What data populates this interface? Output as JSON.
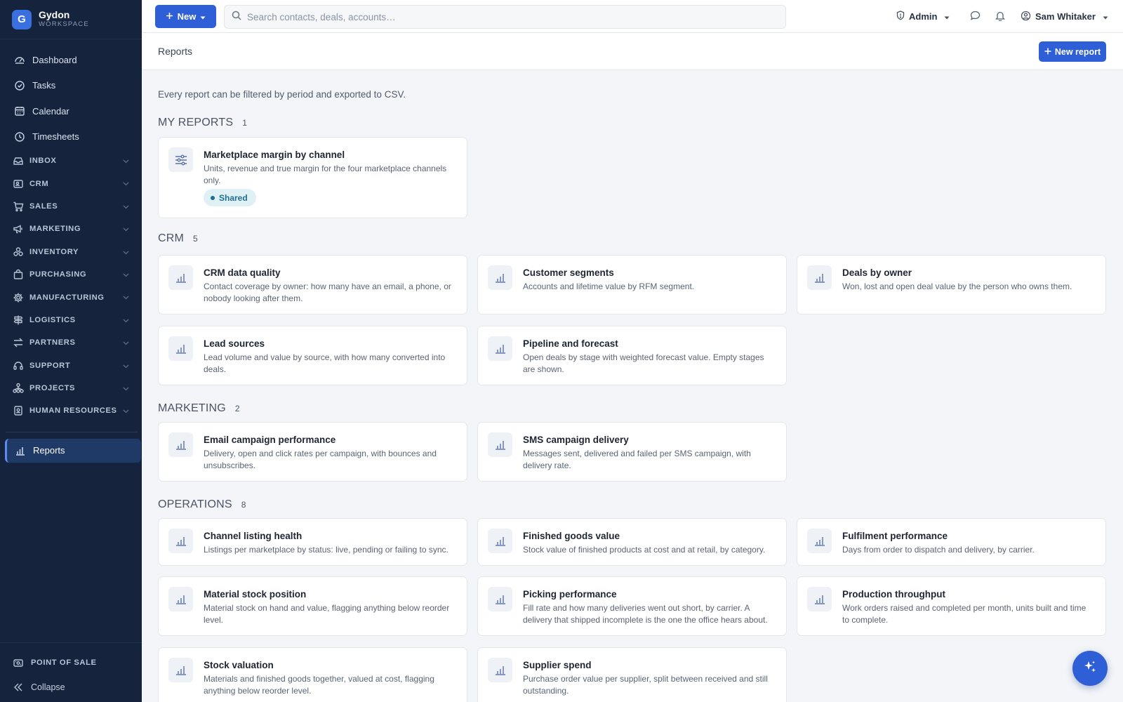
{
  "brand": {
    "logo_letter": "G",
    "name": "Gydon",
    "subtitle": "WORKSPACE"
  },
  "sidebar": {
    "items": [
      {
        "label": "Dashboard",
        "icon": "gauge-icon"
      },
      {
        "label": "Tasks",
        "icon": "check-circle-icon"
      },
      {
        "label": "Calendar",
        "icon": "calendar-icon"
      },
      {
        "label": "Timesheets",
        "icon": "clock-icon"
      }
    ],
    "groups": [
      {
        "label": "INBOX",
        "icon": "inbox-icon"
      },
      {
        "label": "CRM",
        "icon": "contact-card-icon"
      },
      {
        "label": "SALES",
        "icon": "cart-icon"
      },
      {
        "label": "MARKETING",
        "icon": "megaphone-icon"
      },
      {
        "label": "INVENTORY",
        "icon": "boxes-icon"
      },
      {
        "label": "PURCHASING",
        "icon": "bag-icon"
      },
      {
        "label": "MANUFACTURING",
        "icon": "cog-icon"
      },
      {
        "label": "LOGISTICS",
        "icon": "signpost-icon"
      },
      {
        "label": "PARTNERS",
        "icon": "arrows-icon"
      },
      {
        "label": "SUPPORT",
        "icon": "headset-icon"
      },
      {
        "label": "PROJECTS",
        "icon": "network-icon"
      },
      {
        "label": "HUMAN RESOURCES",
        "icon": "badge-icon"
      }
    ],
    "active": {
      "label": "Reports",
      "icon": "bar-chart-icon"
    },
    "bottom": {
      "pos_label": "POINT OF SALE",
      "collapse_label": "Collapse"
    }
  },
  "topbar": {
    "new_label": "New",
    "search_placeholder": "Search contacts, deals, accounts…",
    "admin_label": "Admin",
    "user_name": "Sam Whitaker"
  },
  "page": {
    "title": "Reports",
    "new_report_label": "New report",
    "intro": "Every report can be filtered by period and exported to CSV."
  },
  "sections": {
    "my": {
      "title": "MY REPORTS",
      "count": "1",
      "cards": [
        {
          "title": "Marketplace margin by channel",
          "desc": "Units, revenue and true margin for the four marketplace channels only.",
          "badge": "Shared"
        }
      ]
    },
    "crm": {
      "title": "CRM",
      "count": "5",
      "cards": [
        {
          "title": "CRM data quality",
          "desc": "Contact coverage by owner: how many have an email, a phone, or nobody looking after them."
        },
        {
          "title": "Customer segments",
          "desc": "Accounts and lifetime value by RFM segment."
        },
        {
          "title": "Deals by owner",
          "desc": "Won, lost and open deal value by the person who owns them."
        },
        {
          "title": "Lead sources",
          "desc": "Lead volume and value by source, with how many converted into deals."
        },
        {
          "title": "Pipeline and forecast",
          "desc": "Open deals by stage with weighted forecast value. Empty stages are shown."
        }
      ]
    },
    "marketing": {
      "title": "MARKETING",
      "count": "2",
      "cards": [
        {
          "title": "Email campaign performance",
          "desc": "Delivery, open and click rates per campaign, with bounces and unsubscribes."
        },
        {
          "title": "SMS campaign delivery",
          "desc": "Messages sent, delivered and failed per SMS campaign, with delivery rate."
        }
      ]
    },
    "operations": {
      "title": "OPERATIONS",
      "count": "8",
      "cards": [
        {
          "title": "Channel listing health",
          "desc": "Listings per marketplace by status: live, pending or failing to sync."
        },
        {
          "title": "Finished goods value",
          "desc": "Stock value of finished products at cost and at retail, by category."
        },
        {
          "title": "Fulfilment performance",
          "desc": "Days from order to dispatch and delivery, by carrier."
        },
        {
          "title": "Material stock position",
          "desc": "Material stock on hand and value, flagging anything below reorder level."
        },
        {
          "title": "Picking performance",
          "desc": "Fill rate and how many deliveries went out short, by carrier. A delivery that shipped incomplete is the one the office hears about."
        },
        {
          "title": "Production throughput",
          "desc": "Work orders raised and completed per month, units built and time to complete."
        },
        {
          "title": "Stock valuation",
          "desc": "Materials and finished goods together, valued at cost, flagging anything below reorder level."
        },
        {
          "title": "Supplier spend",
          "desc": "Purchase order value per supplier, split between received and still outstanding."
        }
      ]
    }
  },
  "colors": {
    "accent": "#2f5fd6",
    "sidebar_bg": "#15233d",
    "badge_bg": "#e0f1f6"
  }
}
